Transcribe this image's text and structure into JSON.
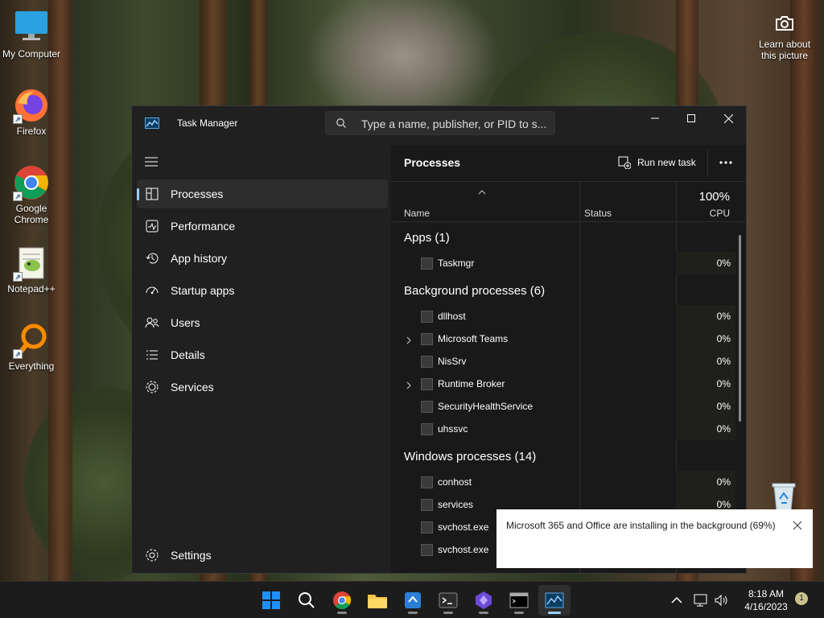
{
  "desktop": {
    "icons": [
      {
        "label": "My Computer"
      },
      {
        "label": "Firefox"
      },
      {
        "label": "Google Chrome"
      },
      {
        "label": "Notepad++"
      },
      {
        "label": "Everything"
      }
    ],
    "learn_label": "Learn about this picture"
  },
  "window": {
    "title": "Task Manager",
    "search_placeholder": "Type a name, publisher, or PID to s...",
    "controls": [
      "minimize-icon",
      "maximize-icon",
      "close-icon"
    ]
  },
  "sidebar": {
    "items": [
      {
        "label": "Processes",
        "icon": "processes-icon",
        "active": true
      },
      {
        "label": "Performance",
        "icon": "performance-icon"
      },
      {
        "label": "App history",
        "icon": "history-icon"
      },
      {
        "label": "Startup apps",
        "icon": "startup-icon"
      },
      {
        "label": "Users",
        "icon": "users-icon"
      },
      {
        "label": "Details",
        "icon": "details-icon"
      },
      {
        "label": "Services",
        "icon": "services-icon"
      }
    ],
    "settings_label": "Settings"
  },
  "main": {
    "title": "Processes",
    "run_new_task": "Run new task",
    "columns": {
      "name": "Name",
      "status": "Status",
      "cpu": "CPU",
      "cpu_total": "100%"
    },
    "groups": [
      {
        "label": "Apps (1)",
        "processes": [
          {
            "name": "Taskmgr",
            "cpu": "0%",
            "expandable": false
          }
        ]
      },
      {
        "label": "Background processes (6)",
        "processes": [
          {
            "name": "dllhost",
            "cpu": "0%",
            "expandable": false
          },
          {
            "name": "Microsoft Teams",
            "cpu": "0%",
            "expandable": true
          },
          {
            "name": "NisSrv",
            "cpu": "0%",
            "expandable": false
          },
          {
            "name": "Runtime Broker",
            "cpu": "0%",
            "expandable": true
          },
          {
            "name": "SecurityHealthService",
            "cpu": "0%",
            "expandable": false
          },
          {
            "name": "uhssvc",
            "cpu": "0%",
            "expandable": false
          }
        ]
      },
      {
        "label": "Windows processes (14)",
        "processes": [
          {
            "name": "conhost",
            "cpu": "0%",
            "expandable": false
          },
          {
            "name": "services",
            "cpu": "0%",
            "expandable": false
          },
          {
            "name": "svchost.exe",
            "cpu": "",
            "expandable": false
          },
          {
            "name": "svchost.exe",
            "cpu": "",
            "expandable": false
          }
        ]
      }
    ]
  },
  "toast": {
    "message": "Microsoft 365 and Office are installing in the background (69%)"
  },
  "taskbar": {
    "apps": [
      "start-icon",
      "search-icon",
      "chrome-icon",
      "file-explorer-icon",
      "azure-data-studio-icon",
      "terminal-icon",
      "visual-studio-icon",
      "cmd-icon",
      "task-manager-icon"
    ],
    "clock": {
      "time": "8:18 AM",
      "date": "4/16/2023"
    },
    "notification_count": "1"
  },
  "colors": {
    "accent": "#9bd0ff",
    "window_bg": "#202020",
    "content_bg": "#191919"
  }
}
